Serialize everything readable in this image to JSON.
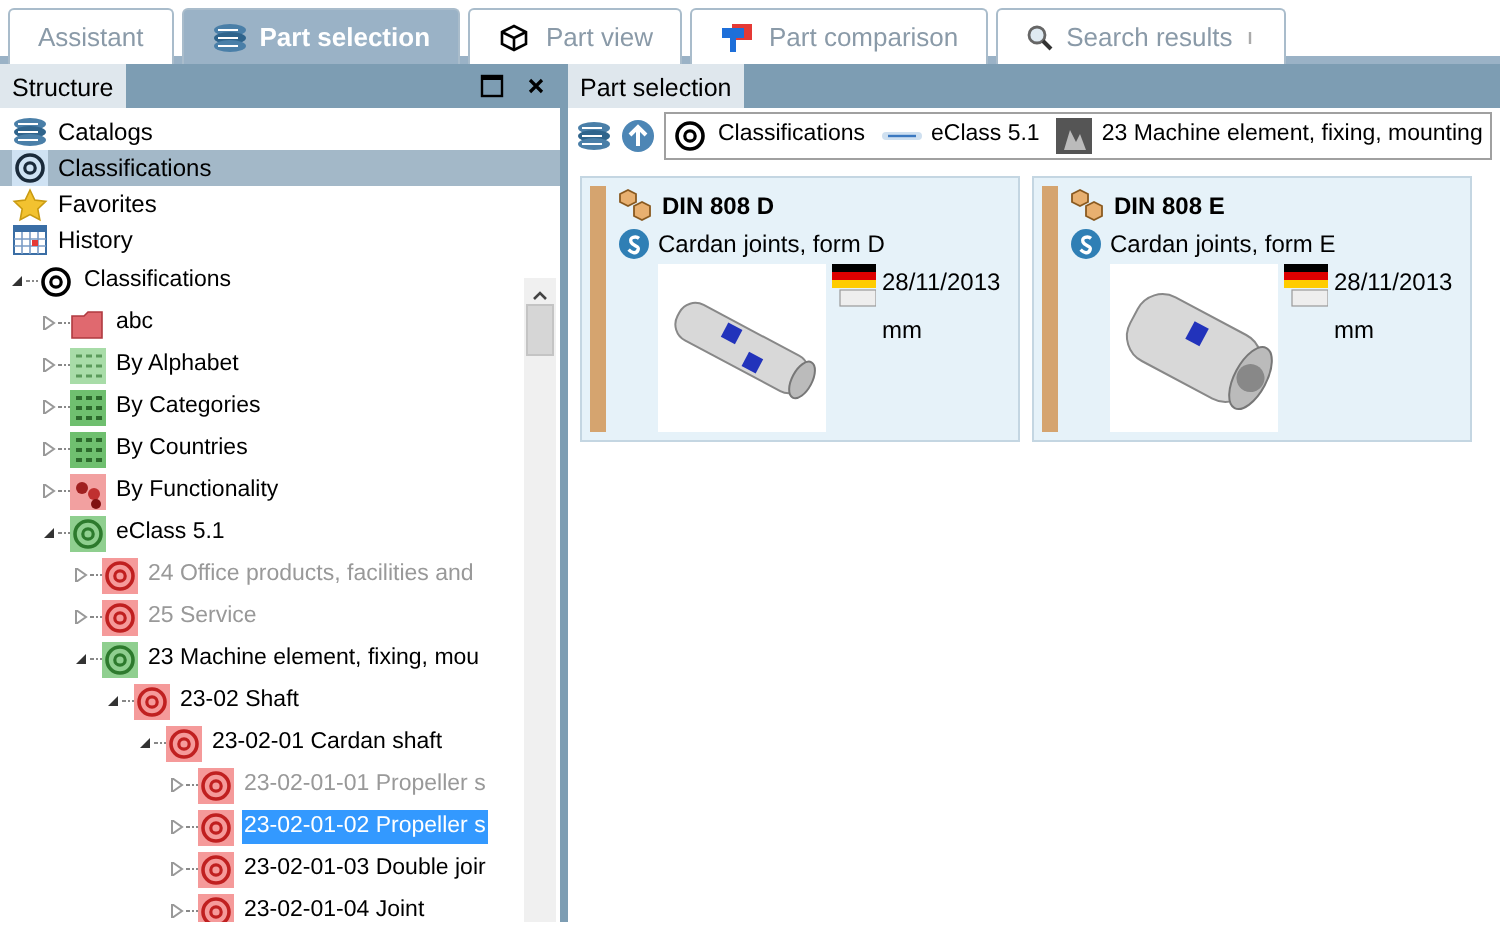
{
  "tabs": [
    {
      "label": "Assistant",
      "kind": "none",
      "selected": false
    },
    {
      "label": "Part selection",
      "kind": "stack",
      "selected": true
    },
    {
      "label": "Part view",
      "kind": "cube",
      "selected": false
    },
    {
      "label": "Part comparison",
      "kind": "compare",
      "selected": false
    },
    {
      "label": "Search results",
      "kind": "search",
      "selected": false
    }
  ],
  "structure_panel": {
    "title": "Structure",
    "nav_items": [
      {
        "label": "Catalogs",
        "kind": "catalogs",
        "selected": false
      },
      {
        "label": "Classifications",
        "kind": "at",
        "selected": true
      },
      {
        "label": "Favorites",
        "kind": "star",
        "selected": false
      },
      {
        "label": "History",
        "kind": "calendar",
        "selected": false
      }
    ],
    "tree": [
      {
        "label": "Classifications",
        "kind": "at-black",
        "expanded": true,
        "dimmed": false,
        "selected": false,
        "children": [
          {
            "label": "abc",
            "kind": "folder",
            "expanded": false,
            "dimmed": false,
            "selected": false
          },
          {
            "label": "By Alphabet",
            "kind": "grid-light",
            "expanded": false,
            "dimmed": false,
            "selected": false
          },
          {
            "label": "By Categories",
            "kind": "grid",
            "expanded": false,
            "dimmed": false,
            "selected": false
          },
          {
            "label": "By Countries",
            "kind": "grid",
            "expanded": false,
            "dimmed": false,
            "selected": false
          },
          {
            "label": "By Functionality",
            "kind": "blob",
            "expanded": false,
            "dimmed": false,
            "selected": false
          },
          {
            "label": "eClass 5.1",
            "kind": "at-green",
            "expanded": true,
            "dimmed": false,
            "selected": false,
            "children": [
              {
                "label": "24 Office products, facilities and",
                "kind": "at-red",
                "expanded": false,
                "dimmed": true,
                "selected": false
              },
              {
                "label": "25 Service",
                "kind": "at-red",
                "expanded": false,
                "dimmed": true,
                "selected": false
              },
              {
                "label": "23 Machine element, fixing, mou",
                "kind": "at-green",
                "expanded": true,
                "dimmed": false,
                "selected": false,
                "children": [
                  {
                    "label": "23-02 Shaft",
                    "kind": "at-red",
                    "expanded": true,
                    "dimmed": false,
                    "selected": false,
                    "children": [
                      {
                        "label": "23-02-01 Cardan shaft",
                        "kind": "at-red",
                        "expanded": true,
                        "dimmed": false,
                        "selected": false,
                        "children": [
                          {
                            "label": "23-02-01-01 Propeller s",
                            "kind": "at-red",
                            "expanded": false,
                            "dimmed": true,
                            "selected": false
                          },
                          {
                            "label": "23-02-01-02 Propeller s",
                            "kind": "at-red",
                            "expanded": false,
                            "dimmed": false,
                            "selected": true
                          },
                          {
                            "label": "23-02-01-03 Double joir",
                            "kind": "at-red",
                            "expanded": false,
                            "dimmed": false,
                            "selected": false
                          },
                          {
                            "label": "23-02-01-04 Joint",
                            "kind": "at-red",
                            "expanded": false,
                            "dimmed": false,
                            "selected": false
                          }
                        ]
                      }
                    ]
                  }
                ]
              }
            ]
          }
        ]
      }
    ]
  },
  "part_panel": {
    "title": "Part selection",
    "breadcrumb": [
      {
        "label": "Classifications",
        "kind": "at-black"
      },
      {
        "label": "eClass 5.1",
        "kind": "eclass"
      },
      {
        "label": "23 Machine element, fixing, mounting",
        "kind": "photo"
      }
    ],
    "parts": [
      {
        "title": "DIN 808 D",
        "description": "Cardan joints, form D",
        "date": "28/11/2013",
        "unit": "mm",
        "kind": "long"
      },
      {
        "title": "DIN 808 E",
        "description": "Cardan joints, form E",
        "date": "28/11/2013",
        "unit": "mm",
        "kind": "short"
      }
    ]
  }
}
